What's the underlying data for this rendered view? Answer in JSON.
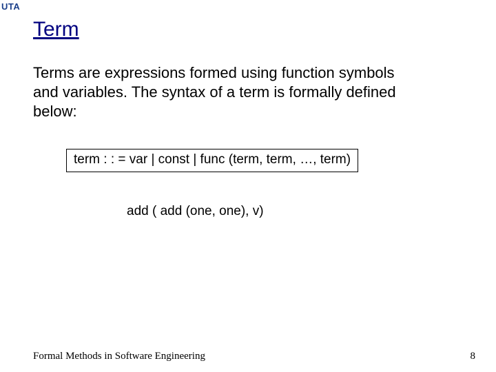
{
  "logo": "UTA",
  "title": "Term",
  "body": "Terms are expressions formed using function symbols and variables. The syntax of a term is formally defined below:",
  "grammar": "term : : = var | const | func (term, term, …, term)",
  "example": "add ( add (one, one), v)",
  "footer": {
    "left": "Formal Methods in Software Engineering",
    "page": "8"
  }
}
